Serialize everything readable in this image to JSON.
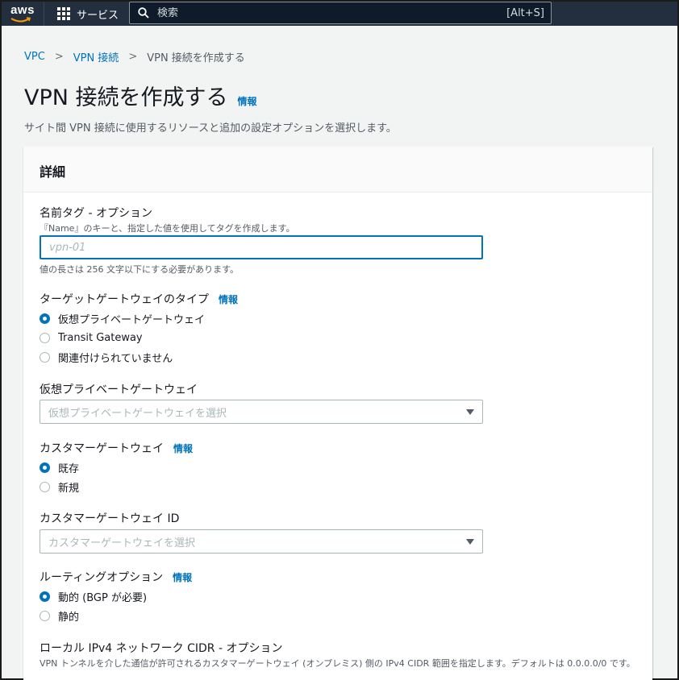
{
  "topbar": {
    "logo": "aws",
    "services_label": "サービス",
    "search_placeholder": "検索",
    "search_shortcut": "[Alt+S]"
  },
  "breadcrumb": {
    "items": [
      "VPC",
      "VPN 接続"
    ],
    "current": "VPN 接続を作成する"
  },
  "page": {
    "title": "VPN 接続を作成する",
    "info": "情報",
    "description": "サイト間 VPN 接続に使用するリソースと追加の設定オプションを選択します。"
  },
  "panel": {
    "title": "詳細",
    "name_tag": {
      "label": "名前タグ - オプション",
      "description": "『Name』のキーと、指定した値を使用してタグを作成します。",
      "placeholder": "vpn-01",
      "constraint": "値の長さは 256 文字以下にする必要があります。"
    },
    "target_gateway_type": {
      "label": "ターゲットゲートウェイのタイプ",
      "info": "情報",
      "options": [
        "仮想プライベートゲートウェイ",
        "Transit Gateway",
        "関連付けられていません"
      ],
      "selected": 0
    },
    "virtual_private_gateway": {
      "label": "仮想プライベートゲートウェイ",
      "placeholder": "仮想プライベートゲートウェイを選択"
    },
    "customer_gateway": {
      "label": "カスタマーゲートウェイ",
      "info": "情報",
      "options": [
        "既存",
        "新規"
      ],
      "selected": 0
    },
    "customer_gateway_id": {
      "label": "カスタマーゲートウェイ ID",
      "placeholder": "カスタマーゲートウェイを選択"
    },
    "routing_options": {
      "label": "ルーティングオプション",
      "info": "情報",
      "options": [
        "動的 (BGP が必要)",
        "静的"
      ],
      "selected": 0
    },
    "local_ipv4_cidr": {
      "label": "ローカル IPv4 ネットワーク CIDR - オプション",
      "description": "VPN トンネルを介した通信が許可されるカスタマーゲートウェイ (オンプレミス) 側の IPv4 CIDR 範囲を指定します。デフォルトは 0.0.0.0/0 です。"
    }
  },
  "colors": {
    "topbar": "#232f3e",
    "link": "#0073bb",
    "radio_selected": "#0073bb"
  }
}
